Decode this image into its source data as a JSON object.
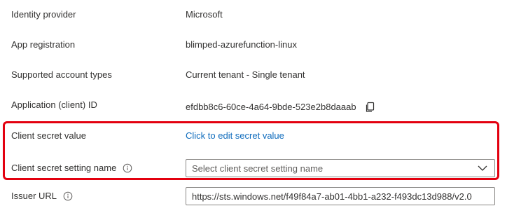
{
  "fields": {
    "identity_provider": {
      "label": "Identity provider",
      "value": "Microsoft"
    },
    "app_registration": {
      "label": "App registration",
      "value": "blimped-azurefunction-linux"
    },
    "supported_account_types": {
      "label": "Supported account types",
      "value": "Current tenant - Single tenant"
    },
    "application_client_id": {
      "label": "Application (client) ID",
      "value": "efdbb8c6-60ce-4a64-9bde-523e2b8daaab",
      "icon": "copy-icon"
    },
    "client_secret_value": {
      "label": "Client secret value",
      "link": "Click to edit secret value"
    },
    "client_secret_setting_name": {
      "label": "Client secret setting name",
      "placeholder": "Select client secret setting name",
      "icon": "info-icon"
    },
    "issuer_url": {
      "label": "Issuer URL",
      "value": "https://sts.windows.net/f49f84a7-ab01-4bb1-a232-f493dc13d988/v2.0",
      "icon": "info-icon"
    }
  },
  "colors": {
    "highlight_border": "#e3000f",
    "link": "#0f6cbd",
    "text": "#323130",
    "placeholder": "#605e5c"
  }
}
